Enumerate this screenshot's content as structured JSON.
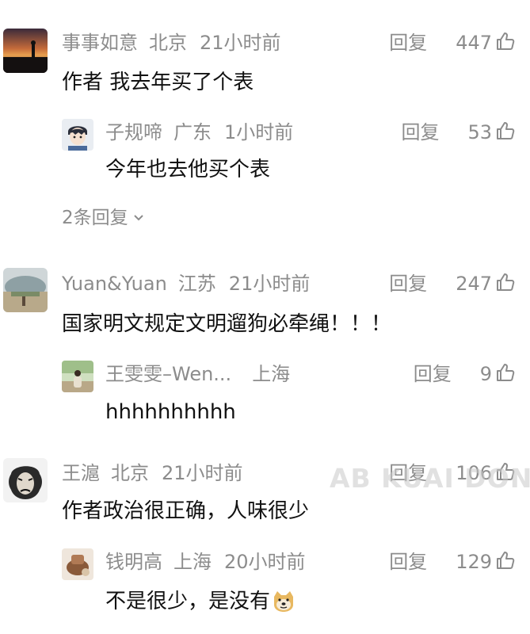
{
  "comments": [
    {
      "user": "事事如意",
      "location": "北京",
      "time": "21小时前",
      "reply_label": "回复",
      "likes": "447",
      "text": "作者  我去年买了个表",
      "reply": {
        "user": "子规啼",
        "location": "广东",
        "time": "1小时前",
        "reply_label": "回复",
        "likes": "53",
        "text": "今年也去他买个表"
      },
      "more_replies": "2条回复"
    },
    {
      "user": "Yuan&Yuan",
      "location": "江苏",
      "time": "21小时前",
      "reply_label": "回复",
      "likes": "247",
      "text": "国家明文规定文明遛狗必牵绳！！！",
      "reply": {
        "user": "王雯雯–Wen...",
        "location": "上海",
        "time": "",
        "reply_label": "回复",
        "likes": "9",
        "text": "hhhhhhhhhh"
      }
    },
    {
      "user": "王滬",
      "location": "北京",
      "time": "21小时前",
      "reply_label": "回复",
      "likes": "106",
      "text": "作者政治很正确，人味很少",
      "reply": {
        "user": "钱明高",
        "location": "上海",
        "time": "20小时前",
        "reply_label": "回复",
        "likes": "129",
        "text": "不是很少，是没有"
      }
    }
  ],
  "watermark": "AB KUAI DONG",
  "icons": {
    "like": "thumbs-up-icon",
    "chevron": "chevron-down-icon",
    "emoji": "doge-emoji-icon"
  },
  "colors": {
    "meta_text": "#8c8c8c",
    "body_text": "#111111",
    "background": "#ffffff"
  }
}
